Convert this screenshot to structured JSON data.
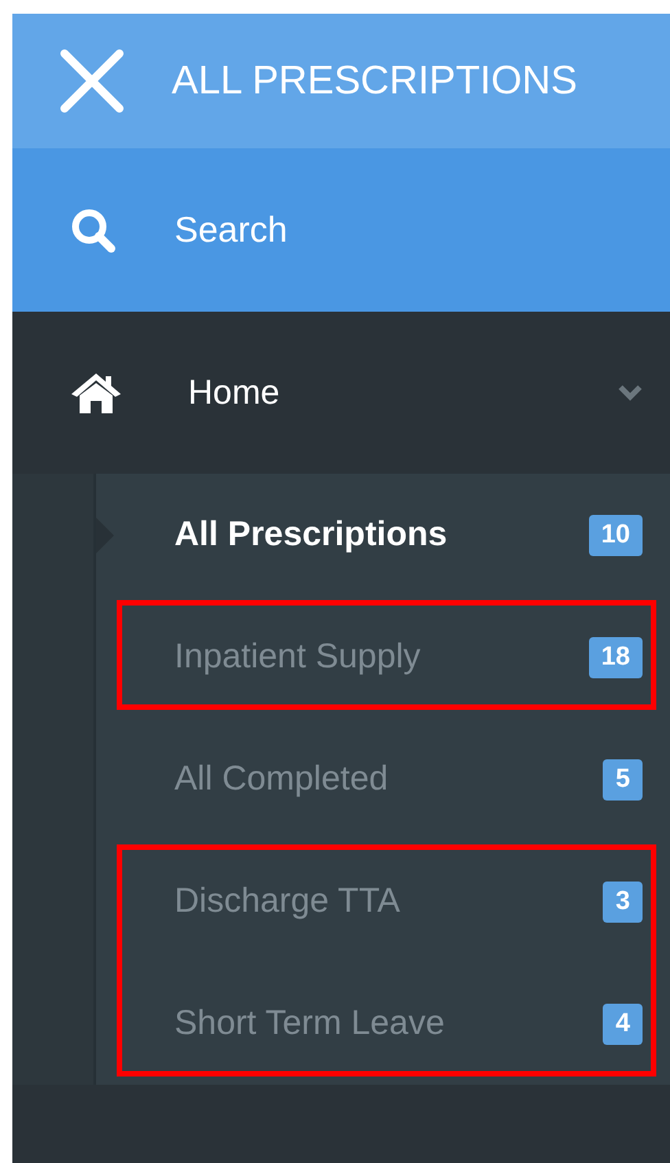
{
  "header": {
    "title": "ALL PRESCRIPTIONS"
  },
  "search": {
    "label": "Search"
  },
  "menu": [
    {
      "label": "Home",
      "expanded": true,
      "children": [
        {
          "label": "All Prescriptions",
          "count": "10",
          "selected": true,
          "highlighted": false
        },
        {
          "label": "Inpatient Supply",
          "count": "18",
          "selected": false,
          "highlighted": true
        },
        {
          "label": "All Completed",
          "count": "5",
          "selected": false,
          "highlighted": false
        },
        {
          "label": "Discharge TTA",
          "count": "3",
          "selected": false,
          "highlighted": true
        },
        {
          "label": "Short Term Leave",
          "count": "4",
          "selected": false,
          "highlighted": true
        }
      ]
    }
  ]
}
